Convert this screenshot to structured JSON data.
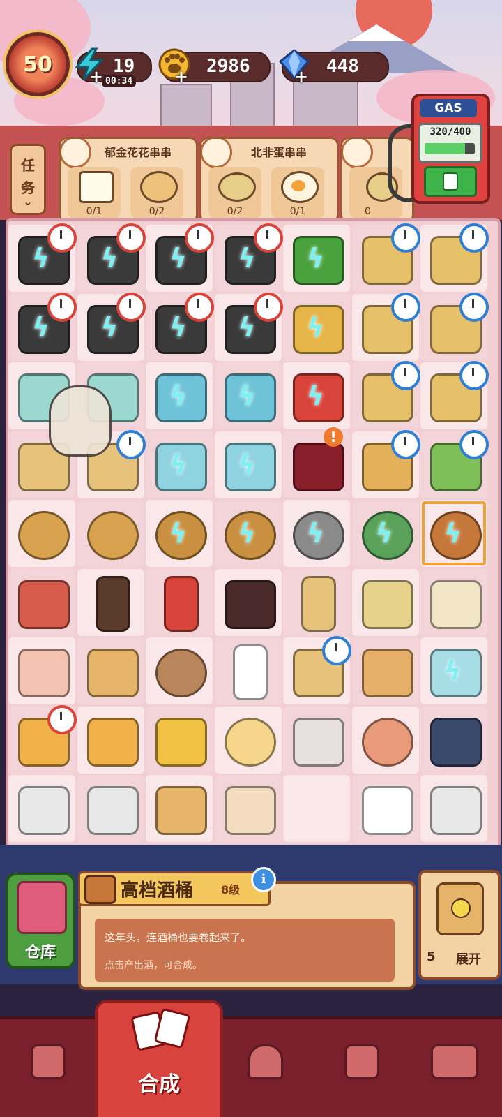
{
  "hud": {
    "level": "50",
    "energy": "19",
    "energy_timer": "00:34",
    "coins": "2986",
    "gems": "448",
    "plus": "+"
  },
  "tasks": {
    "button_label_1": "任",
    "button_label_2": "务",
    "orders": [
      {
        "title": "郁金花花串串",
        "requirements": [
          {
            "count": "0/1"
          },
          {
            "count": "0/2"
          }
        ]
      },
      {
        "title": "北非蛋串串",
        "requirements": [
          {
            "count": "0/2"
          },
          {
            "count": "0/1"
          }
        ]
      },
      {
        "title": "",
        "requirements": [
          {
            "count": "0"
          }
        ]
      }
    ]
  },
  "gas": {
    "label": "GAS",
    "value": "320/400",
    "fill_fraction": 0.8
  },
  "info": {
    "item_name": "高档酒桶",
    "item_level": "8级",
    "description": "这年头，连酒桶也要卷起来了。",
    "hint": "点击产出酒，可合成。",
    "info_icon": "i"
  },
  "storage": {
    "label": "仓库"
  },
  "expand": {
    "count": "5",
    "label": "展开"
  },
  "nav": {
    "active_label": "合成"
  },
  "colors": {
    "accent_red": "#d8433e",
    "board_pink": "#f1cfd3",
    "panel_tan": "#f3d2a4"
  }
}
